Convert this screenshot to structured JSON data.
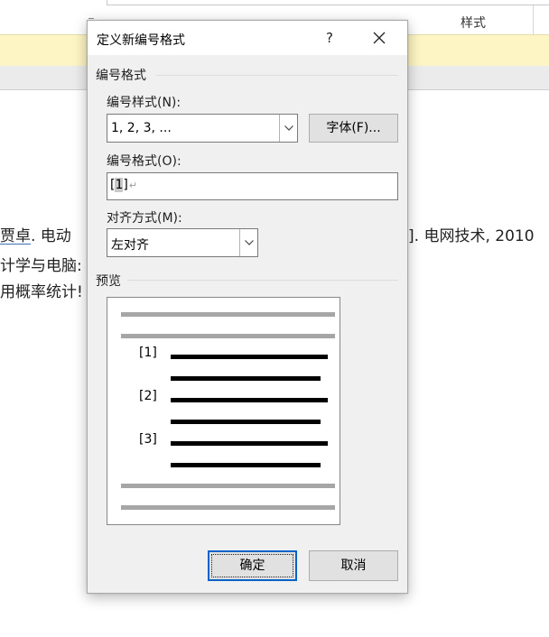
{
  "background_document": {
    "column_header_label": "样式",
    "line1_author": "贾卓",
    "line1_start_rest": ". 电动",
    "line1_end": "]. 电网技术, 2010",
    "line2": "计学与电脑:",
    "line3": "用概率统计!"
  },
  "dialog": {
    "title": "定义新编号格式",
    "help_symbol": "?",
    "section_number_format": "编号格式",
    "number_style_label": "编号样式(N):",
    "number_style_value": "1, 2, 3, ...",
    "font_button_label": "字体(F)...",
    "number_format_label": "编号格式(O):",
    "number_format_value": {
      "open_bracket": "[",
      "field": "1",
      "close_bracket": "]",
      "paragraph_mark": "↵"
    },
    "alignment_label": "对齐方式(M):",
    "alignment_value": "左对齐",
    "preview_label": "预览",
    "preview_numbers": [
      "[1]",
      "[2]",
      "[3]"
    ],
    "ok_button_label": "确定",
    "cancel_button_label": "取消"
  },
  "colors": {
    "yellow_bar": "#fdf5c3",
    "primary_button_border": "#0a64c8",
    "dialog_background": "#f0f0f0"
  }
}
